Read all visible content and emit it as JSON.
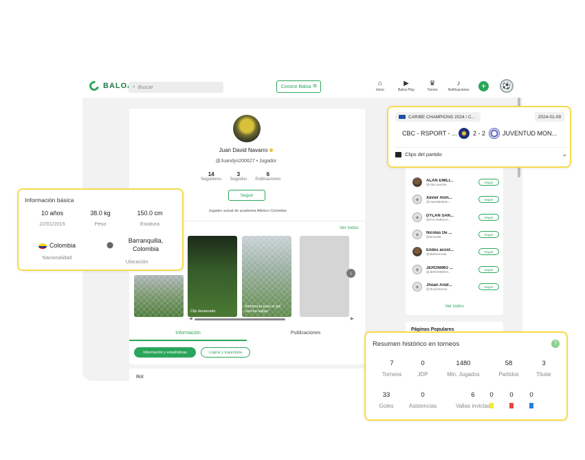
{
  "app": {
    "logo_text": "BALOA",
    "search_placeholder": "Buscar",
    "conoce_label": "Conoce Baloa",
    "nav": [
      {
        "label": "Inicio",
        "icon": "home-icon",
        "glyph": "⌂"
      },
      {
        "label": "Baloa Play",
        "icon": "play-icon",
        "glyph": "▶"
      },
      {
        "label": "Torneo",
        "icon": "trophy-icon",
        "glyph": "♛"
      },
      {
        "label": "Notificaciones",
        "icon": "bell-icon",
        "glyph": "♪"
      }
    ],
    "plus_label": "+"
  },
  "profile": {
    "name": "Juan David Navarro",
    "handle": "@Juandyn200627 • Jugador",
    "stats": [
      {
        "value": "14",
        "label": "Seguidores"
      },
      {
        "value": "3",
        "label": "Seguidos"
      },
      {
        "value": "6",
        "label": "Publicaciones"
      }
    ],
    "follow_label": "Seguir",
    "bio": "Jugador actual de academia Atletico Colombia",
    "ver_todos": "Ver todos",
    "clips": [
      {
        "caption": ""
      },
      {
        "caption": "Clip destacado"
      },
      {
        "caption": "Asistencia para el gol cancha salgar"
      },
      {
        "caption": ""
      }
    ],
    "tabs": [
      "Información",
      "Publicaciones"
    ],
    "pills": [
      "Información y estadísticas",
      "Logros y trayectoria"
    ],
    "rol_label": "Rol"
  },
  "basic_info": {
    "title": "Información básica",
    "age": {
      "value": "10 años",
      "label": "22/01/2015"
    },
    "weight": {
      "value": "38.0 kg",
      "label": "Peso"
    },
    "height": {
      "value": "150.0 cm",
      "label": "Estatura"
    },
    "nationality": {
      "value": "Colombia",
      "label": "Nacionalidad"
    },
    "location": {
      "value": "Barranquilla, Colombia",
      "label": "Ubicación"
    }
  },
  "match": {
    "tournament": "CARIBE CHAMPIONS 2024 / C...",
    "date": "2024-01-09",
    "home": "CBC - RSPORT - ...",
    "score": "2 - 2",
    "away": "JUVENTUD MON...",
    "clips_label": "Clips del partido"
  },
  "followers": {
    "items": [
      {
        "name": "ALAN EMILI...",
        "handle": "@Alan.sanche...",
        "photo": true
      },
      {
        "name": "Xavier Alon...",
        "handle": "@XavierBeltran...",
        "photo": false
      },
      {
        "name": "DYLAN SAN...",
        "handle": "@DYLANROJA...",
        "photo": false
      },
      {
        "name": "Nicolás De ...",
        "handle": "@decas96",
        "photo": false
      },
      {
        "name": "Elides acost...",
        "handle": "@elidesacosta",
        "photo": true
      },
      {
        "name": "JERONIMO ...",
        "handle": "@JERONIMOO...",
        "photo": false
      },
      {
        "name": "Jhoan Andr...",
        "handle": "@JhoanGanza...",
        "photo": false
      }
    ],
    "follow_label": "Seguir",
    "ver_todos": "Ver todos",
    "paginas_label": "Páginas Populares"
  },
  "history": {
    "title": "Resumen histórico en torneos",
    "help": "?",
    "row1": [
      {
        "value": "7",
        "label": "Torneos"
      },
      {
        "value": "0",
        "label": "JDP"
      },
      {
        "value": "1480",
        "label": "Min. Jugados"
      },
      {
        "value": "58",
        "label": "Partidos"
      },
      {
        "value": "3",
        "label": "Titular"
      }
    ],
    "row2": [
      {
        "value": "33",
        "label": "Goles"
      },
      {
        "value": "0",
        "label": "Asistencias"
      },
      {
        "value": "6",
        "label": "Vallas invictas"
      }
    ],
    "cards": [
      {
        "value": "0",
        "color": "#f2e53c"
      },
      {
        "value": "0",
        "color": "#e8453c"
      },
      {
        "value": "0",
        "color": "#2a7de1"
      }
    ]
  }
}
